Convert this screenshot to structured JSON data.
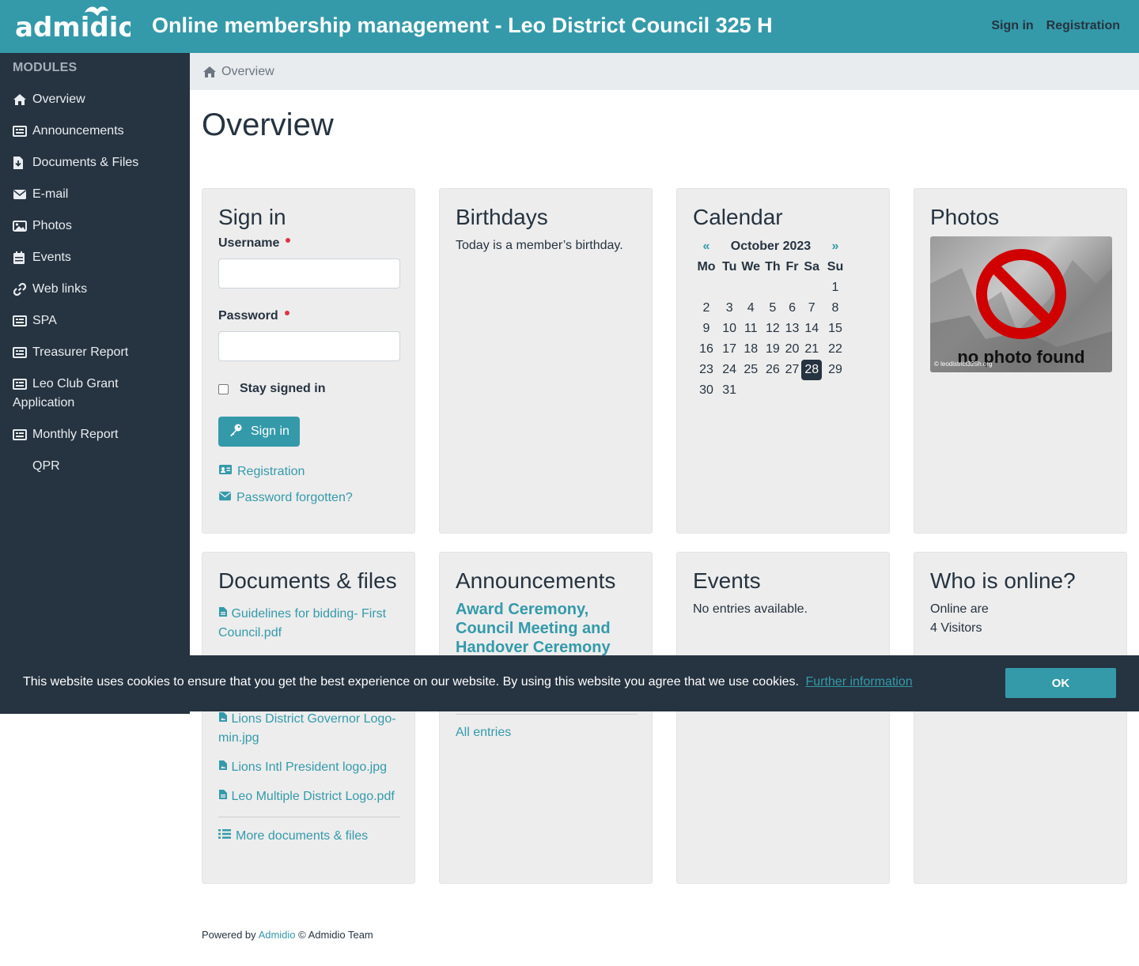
{
  "header": {
    "logo_text": "admidio",
    "title": "Online membership management - Leo District Council 325 H",
    "links": {
      "signin": "Sign in",
      "registration": "Registration"
    }
  },
  "sidebar": {
    "heading": "MODULES",
    "items": [
      {
        "label": "Overview",
        "icon": "home-icon"
      },
      {
        "label": "Announcements",
        "icon": "newspaper-icon"
      },
      {
        "label": "Documents & Files",
        "icon": "file-download-icon"
      },
      {
        "label": "E-mail",
        "icon": "envelope-icon"
      },
      {
        "label": "Photos",
        "icon": "image-icon"
      },
      {
        "label": "Events",
        "icon": "calendar-icon"
      },
      {
        "label": "Web links",
        "icon": "link-icon"
      },
      {
        "label": "SPA",
        "icon": "newspaper-icon"
      },
      {
        "label": "Treasurer Report",
        "icon": "newspaper-icon"
      },
      {
        "label": "Leo Club Grant Application",
        "icon": "newspaper-icon"
      },
      {
        "label": "Monthly Report",
        "icon": "newspaper-icon"
      },
      {
        "label": "QPR",
        "icon": ""
      }
    ]
  },
  "breadcrumb": {
    "label": "Overview"
  },
  "page": {
    "title": "Overview"
  },
  "signin_card": {
    "title": "Sign in",
    "username_label": "Username",
    "username_value": "",
    "password_label": "Password",
    "password_value": "",
    "stay_signed_in": "Stay signed in",
    "button": "Sign in",
    "registration_link": "Registration",
    "forgot_link": "Password forgotten?"
  },
  "birthdays_card": {
    "title": "Birthdays",
    "text": "Today is a member’s birthday."
  },
  "calendar_card": {
    "title": "Calendar",
    "prev": "«",
    "next": "»",
    "month": "October 2023",
    "weekdays": [
      "Mo",
      "Tu",
      "We",
      "Th",
      "Fr",
      "Sa",
      "Su"
    ],
    "weeks": [
      [
        "",
        "",
        "",
        "",
        "",
        "",
        "1"
      ],
      [
        "2",
        "3",
        "4",
        "5",
        "6",
        "7",
        "8"
      ],
      [
        "9",
        "10",
        "11",
        "12",
        "13",
        "14",
        "15"
      ],
      [
        "16",
        "17",
        "18",
        "19",
        "20",
        "21",
        "22"
      ],
      [
        "23",
        "24",
        "25",
        "26",
        "27",
        "28",
        "29"
      ],
      [
        "30",
        "31",
        "",
        "",
        "",
        "",
        ""
      ]
    ],
    "today": "28"
  },
  "photos_card": {
    "title": "Photos",
    "placeholder_text": "no photo found",
    "watermark": "© leodistrict325h.org"
  },
  "documents_card": {
    "title": "Documents & files",
    "files": [
      "Guidelines for bidding- First Council.pdf",
      "Lions District Governor Logo-min.jpg",
      "Lions Intl President logo.jpg",
      "Leo Multiple District Logo.pdf"
    ],
    "more": "More documents & files"
  },
  "announcements_card": {
    "title": "Announcements",
    "item_title": "Award Ceremony, Council Meeting and Handover Ceremony",
    "all_entries": "All entries"
  },
  "events_card": {
    "title": "Events",
    "text": "No entries available."
  },
  "online_card": {
    "title": "Who is online?",
    "line1": "Online are",
    "line2": "4 Visitors"
  },
  "cookie": {
    "text": "This website uses cookies to ensure that you get the best experience on our website. By using this website you agree that we use cookies.",
    "more": "Further information",
    "ok": "OK"
  },
  "footer": {
    "prefix": "Powered by",
    "link": "Admidio",
    "suffix": "© Admidio Team"
  },
  "colors": {
    "accent": "#349aaa",
    "dark": "#263340",
    "card": "#ededed"
  }
}
